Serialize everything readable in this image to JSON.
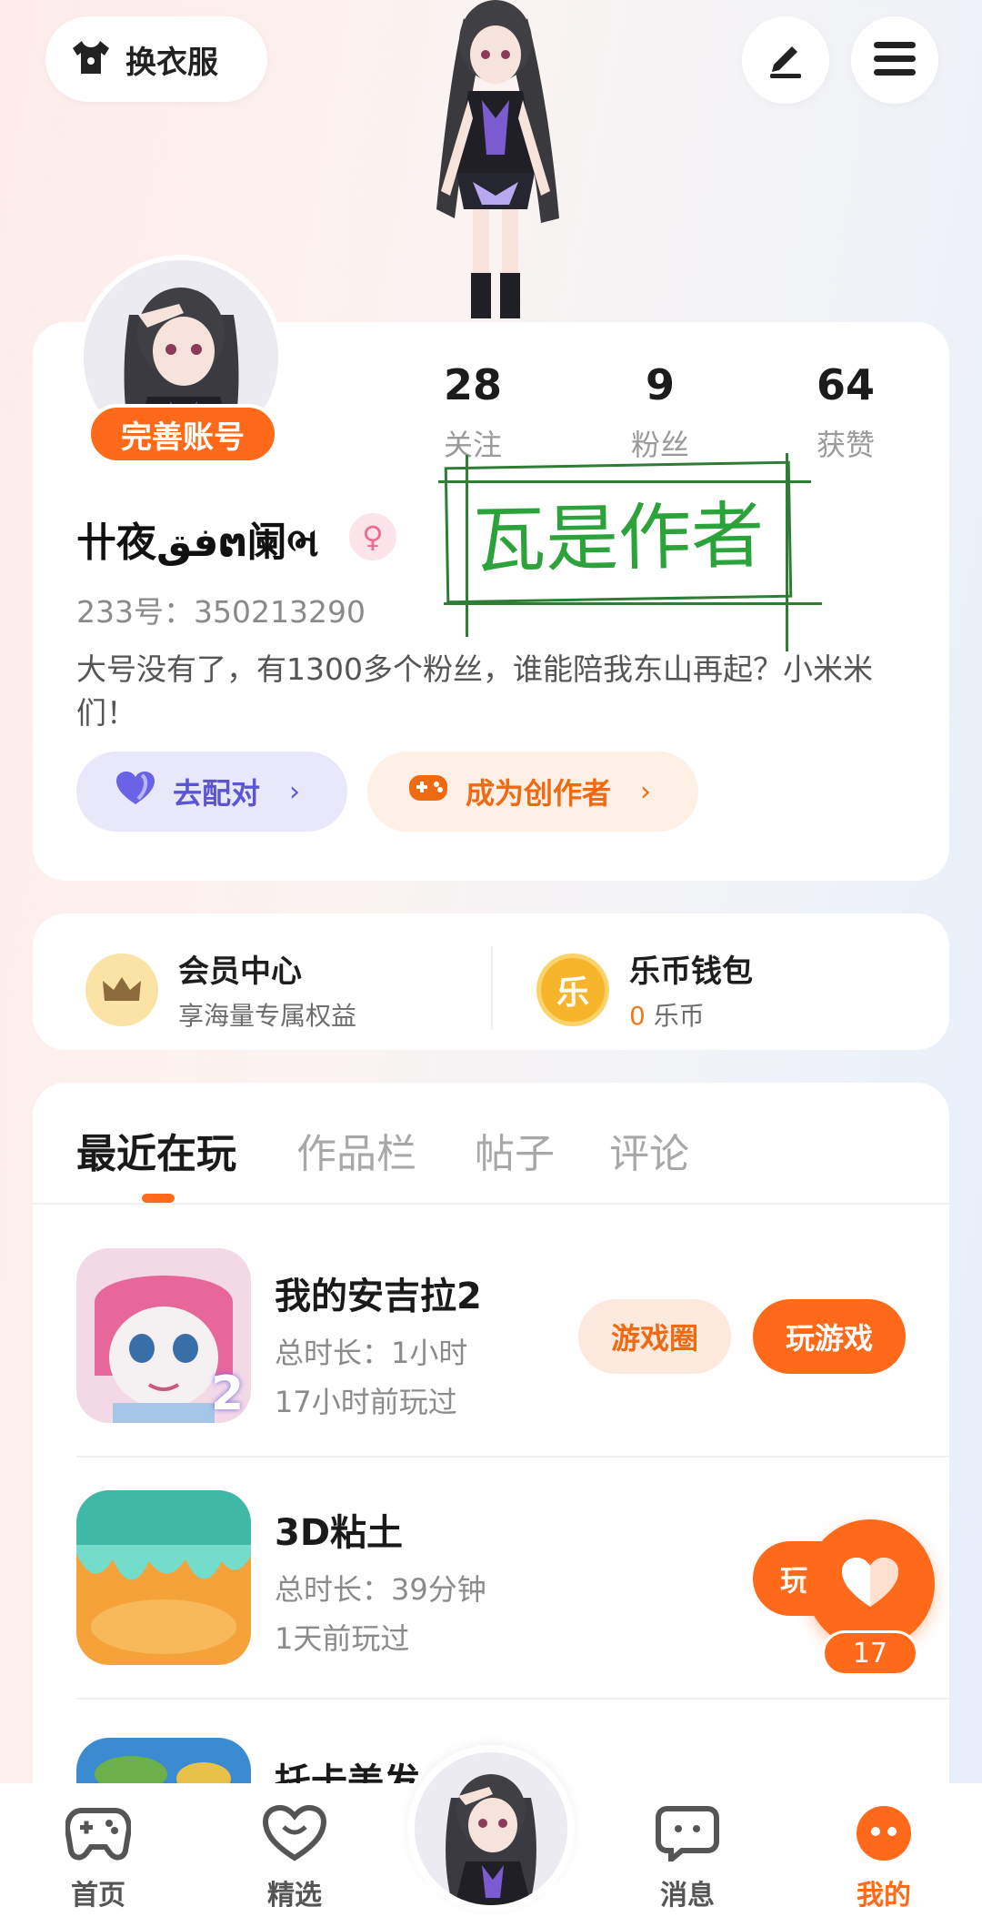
{
  "top_bar": {
    "dress_label": "换衣服",
    "icons": [
      "shirt-icon",
      "edit-icon",
      "menu-icon"
    ]
  },
  "profile": {
    "complete_label": "完善账号",
    "stats": [
      {
        "num": "28",
        "label": "关注"
      },
      {
        "num": "9",
        "label": "粉丝"
      },
      {
        "num": "64",
        "label": "获赞"
      }
    ],
    "username": "卄夜ڧقຕ阑ભ",
    "gender_symbol": "♀",
    "uid": "233号：350213290",
    "bio": "大号没有了，有1300多个粉丝，谁能陪我东山再起？小米米们！",
    "match_label": "去配对",
    "creator_label": "成为创作者",
    "stamp_text": "瓦是作者"
  },
  "wallet": {
    "vip_title": "会员中心",
    "vip_sub": "享海量专属权益",
    "coin_title": "乐币钱包",
    "coin_amount": "0",
    "coin_unit": " 乐币",
    "coin_icon_char": "乐"
  },
  "tabs": [
    "最近在玩",
    "作品栏",
    "帖子",
    "评论"
  ],
  "games": [
    {
      "title": "我的安吉拉2",
      "duration": "总时长：1小时",
      "last": "17小时前玩过",
      "circle_label": "游戏圈",
      "play_label": "玩游戏",
      "badge": "2"
    },
    {
      "title": "3D粘土",
      "duration": "总时长：39分钟",
      "last": "1天前玩过",
      "play_label": "玩"
    },
    {
      "title": "托卡美发"
    }
  ],
  "floating": {
    "like_count": "17"
  },
  "nav": {
    "home": "首页",
    "featured": "精选",
    "messages": "消息",
    "mine": "我的"
  },
  "colors": {
    "accent": "#ff6a1a",
    "purple": "#5b55d6",
    "stamp": "#2ba23a"
  }
}
